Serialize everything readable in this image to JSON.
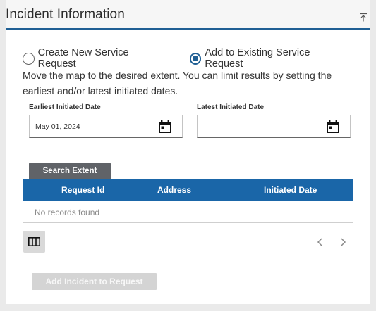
{
  "header": {
    "title": "Incident Information"
  },
  "mode": {
    "options": [
      {
        "label": "Create New Service Request",
        "checked": false
      },
      {
        "label": "Add to Existing Service Request",
        "checked": true
      }
    ]
  },
  "instructions": "Move the map to the desired extent. You can limit results by setting the earliest and/or latest initiated dates.",
  "dates": {
    "earliest": {
      "label": "Earliest Initiated Date",
      "value": "May 01, 2024"
    },
    "latest": {
      "label": "Latest Initiated Date",
      "value": ""
    }
  },
  "search": {
    "label": "Search Extent"
  },
  "grid": {
    "columns": [
      "Request Id",
      "Address",
      "Initiated Date"
    ],
    "empty_text": "No records found"
  },
  "actions": {
    "add_label": "Add Incident to Request"
  },
  "colors": {
    "accent": "#1f5f94",
    "grid_header": "#1a66a8",
    "button_dark": "#606368",
    "disabled": "#d4d4d4"
  }
}
